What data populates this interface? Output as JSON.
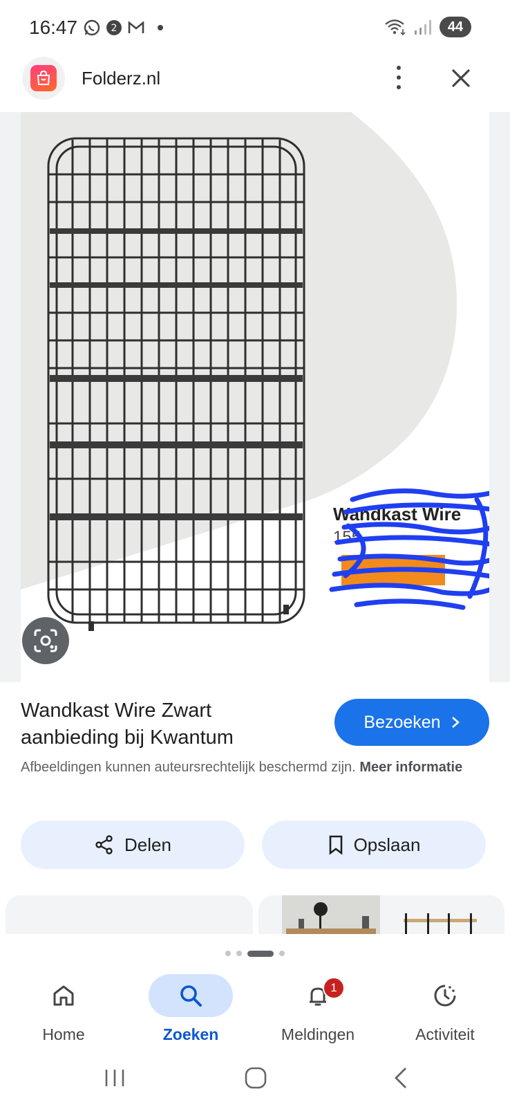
{
  "status_bar": {
    "time": "16:47",
    "left_icons": [
      "whatsapp-icon",
      "app-notification-icon",
      "gmail-icon"
    ],
    "battery": "44"
  },
  "header": {
    "site_name": "Folderz.nl"
  },
  "product": {
    "overlay_name": "Wandkast Wire",
    "overlay_price": "155"
  },
  "result": {
    "title": "Wandkast Wire Zwart aanbieding bij Kwantum",
    "visit_label": "Bezoeken",
    "copyright_text": "Afbeeldingen kunnen auteursrechtelijk beschermd zijn.",
    "copyright_link": "Meer informatie"
  },
  "actions": {
    "share_label": "Delen",
    "save_label": "Opslaan"
  },
  "pager": {
    "count": 4,
    "active_index": 2
  },
  "bottom_nav": {
    "items": [
      {
        "label": "Home",
        "icon": "home-icon"
      },
      {
        "label": "Zoeken",
        "icon": "search-icon",
        "active": true
      },
      {
        "label": "Meldingen",
        "icon": "bell-icon",
        "badge": "1"
      },
      {
        "label": "Activiteit",
        "icon": "activity-icon"
      }
    ]
  },
  "colors": {
    "accent": "#1a73e8",
    "active_nav": "#0b57d0",
    "chip_bg": "#e8f0fe",
    "badge": "#c5221f"
  }
}
